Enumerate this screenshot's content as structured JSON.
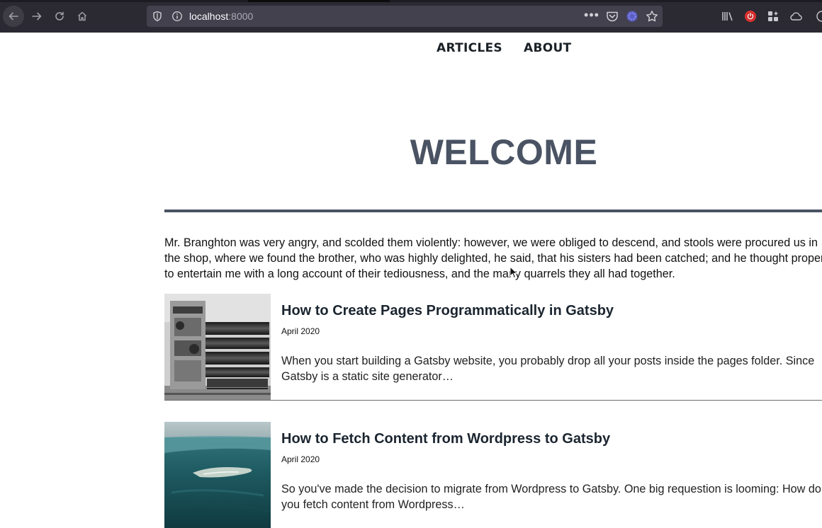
{
  "browser": {
    "url_host": "localhost",
    "url_port": ":8000",
    "icons": {
      "back": "arrow-left-icon",
      "forward": "arrow-right-icon",
      "reload": "reload-icon",
      "home": "home-icon",
      "tracking": "shield-icon",
      "site_info": "info-icon",
      "page_actions": "more-dots-icon",
      "pocket": "pocket-icon",
      "extension": "extension-icon",
      "bookmark": "star-icon",
      "library": "library-icon",
      "power": "power-icon",
      "addons": "grid-icon",
      "sync": "cloud-icon"
    }
  },
  "nav": {
    "items": [
      {
        "label": "ARTICLES"
      },
      {
        "label": "ABOUT"
      }
    ]
  },
  "hero": {
    "title": "WELCOME"
  },
  "intro": {
    "text": "Mr. Branghton was very angry, and scolded them violently: however, we were obliged to descend, and stools were procured us in the shop, where we found the brother, who was highly delighted, he said, that his sisters had been catched; and he thought proper to entertain me with a long account of their tediousness, and the many quarrels they all had together."
  },
  "posts": [
    {
      "title": "How to Create Pages Programmatically in Gatsby",
      "date": "April 2020",
      "excerpt": "When you start building a Gatsby website, you probably drop all your posts inside the pages folder. Since Gatsby is a static site generator…"
    },
    {
      "title": "How to Fetch Content from Wordpress to Gatsby",
      "date": "April 2020",
      "excerpt": "So you've made the decision to migrate from Wordpress to Gatsby. One big requestion is looming: How do you fetch content from Wordpress…"
    }
  ],
  "colors": {
    "heading": "#4a5363",
    "chrome_bg": "#2b2a33",
    "urlbar_bg": "#42414d"
  }
}
